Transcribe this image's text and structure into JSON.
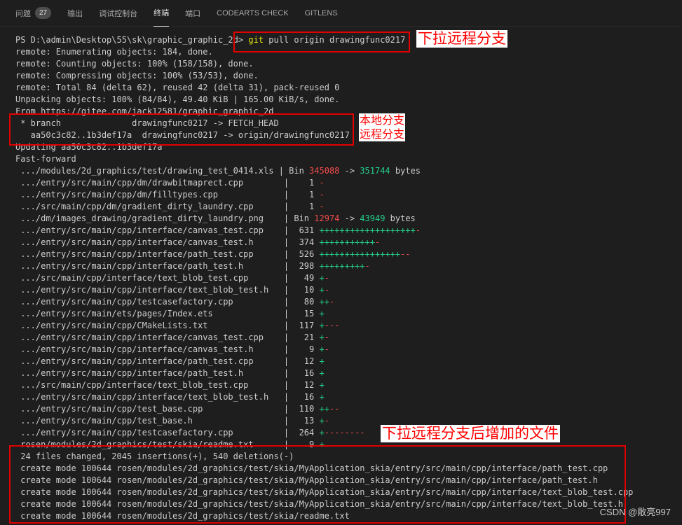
{
  "panel_tabs": [
    {
      "label": "问题",
      "badge": "27"
    },
    {
      "label": "输出"
    },
    {
      "label": "调试控制台"
    },
    {
      "label": "终端",
      "active": true
    },
    {
      "label": "端口"
    },
    {
      "label": "CODEARTS CHECK"
    },
    {
      "label": "GITLENS"
    }
  ],
  "terminal": {
    "prompt": "PS D:\\admin\\Desktop\\55\\sk\\graphic_graphic_2d>",
    "command_git": "git",
    "command_rest": " pull origin drawingfunc0217",
    "lines_head": [
      "remote: Enumerating objects: 184, done.",
      "remote: Counting objects: 100% (158/158), done.",
      "remote: Compressing objects: 100% (53/53), done.",
      "remote: Total 84 (delta 62), reused 42 (delta 31), pack-reused 0",
      "Unpacking objects: 100% (84/84), 49.40 KiB | 165.00 KiB/s, done.",
      "From https://gitee.com/jack12581/graphic_graphic_2d",
      " * branch              drawingfunc0217 -> FETCH_HEAD",
      "   aa50c3c82..1b3def17a  drawingfunc0217 -> origin/drawingfunc0217",
      "Updating aa50c3c82..1b3def17a",
      "Fast-forward"
    ],
    "diffstat": [
      {
        "file": " .../modules/2d_graphics/test/drawing_test_0414.xls ",
        "bin": true,
        "from": "345088",
        "to": "351744",
        "unit": " bytes"
      },
      {
        "file": " .../entry/src/main/cpp/dm/drawbitmaprect.cpp        ",
        "count": "   1 ",
        "plus": "",
        "minus": "-"
      },
      {
        "file": " .../entry/src/main/cpp/dm/filltypes.cpp             ",
        "count": "   1 ",
        "plus": "",
        "minus": "-"
      },
      {
        "file": " .../src/main/cpp/dm/gradient_dirty_laundry.cpp      ",
        "count": "   1 ",
        "plus": "",
        "minus": "-"
      },
      {
        "file": " .../dm/images_drawing/gradient_dirty_laundry.png    ",
        "bin": true,
        "from": "12974",
        "to": "43949",
        "unit": " bytes"
      },
      {
        "file": " .../entry/src/main/cpp/interface/canvas_test.cpp    ",
        "count": " 631 ",
        "plus": "+++++++++++++++++++",
        "minus": "-"
      },
      {
        "file": " .../entry/src/main/cpp/interface/canvas_test.h      ",
        "count": " 374 ",
        "plus": "+++++++++++",
        "minus": "-"
      },
      {
        "file": " .../entry/src/main/cpp/interface/path_test.cpp      ",
        "count": " 526 ",
        "plus": "++++++++++++++++",
        "minus": "--"
      },
      {
        "file": " .../entry/src/main/cpp/interface/path_test.h        ",
        "count": " 298 ",
        "plus": "+++++++++",
        "minus": "-"
      },
      {
        "file": " .../src/main/cpp/interface/text_blob_test.cpp       ",
        "count": "  49 ",
        "plus": "+",
        "minus": "-"
      },
      {
        "file": " .../entry/src/main/cpp/interface/text_blob_test.h   ",
        "count": "  10 ",
        "plus": "+",
        "minus": "-"
      },
      {
        "file": " .../entry/src/main/cpp/testcasefactory.cpp          ",
        "count": "  80 ",
        "plus": "++",
        "minus": "-"
      },
      {
        "file": " .../entry/src/main/ets/pages/Index.ets              ",
        "count": "  15 ",
        "plus": "+",
        "minus": ""
      },
      {
        "file": " .../entry/src/main/cpp/CMakeLists.txt               ",
        "count": " 117 ",
        "plus": "+",
        "minus": "---"
      },
      {
        "file": " .../entry/src/main/cpp/interface/canvas_test.cpp    ",
        "count": "  21 ",
        "plus": "+",
        "minus": "-"
      },
      {
        "file": " .../entry/src/main/cpp/interface/canvas_test.h      ",
        "count": "   9 ",
        "plus": "+",
        "minus": "-"
      },
      {
        "file": " .../entry/src/main/cpp/interface/path_test.cpp      ",
        "count": "  12 ",
        "plus": "+",
        "minus": ""
      },
      {
        "file": " .../entry/src/main/cpp/interface/path_test.h        ",
        "count": "  16 ",
        "plus": "+",
        "minus": ""
      },
      {
        "file": " .../src/main/cpp/interface/text_blob_test.cpp       ",
        "count": "  12 ",
        "plus": "+",
        "minus": ""
      },
      {
        "file": " .../entry/src/main/cpp/interface/text_blob_test.h   ",
        "count": "  16 ",
        "plus": "+",
        "minus": ""
      },
      {
        "file": " .../entry/src/main/cpp/test_base.cpp                ",
        "count": " 110 ",
        "plus": "++",
        "minus": "--"
      },
      {
        "file": " .../entry/src/main/cpp/test_base.h                  ",
        "count": "  13 ",
        "plus": "+",
        "minus": "-"
      },
      {
        "file": " .../entry/src/main/cpp/testcasefactory.cpp          ",
        "count": " 264 ",
        "plus": "+",
        "minus": "--------"
      },
      {
        "file": " rosen/modules/2d_graphics/test/skia/readme.txt      ",
        "count": "   9 ",
        "plus": "+",
        "minus": ""
      }
    ],
    "summary": " 24 files changed, 2045 insertions(+), 540 deletions(-)",
    "create_lines": [
      " create mode 100644 rosen/modules/2d_graphics/test/skia/MyApplication_skia/entry/src/main/cpp/interface/path_test.cpp",
      " create mode 100644 rosen/modules/2d_graphics/test/skia/MyApplication_skia/entry/src/main/cpp/interface/path_test.h",
      " create mode 100644 rosen/modules/2d_graphics/test/skia/MyApplication_skia/entry/src/main/cpp/interface/text_blob_test.cpp",
      " create mode 100644 rosen/modules/2d_graphics/test/skia/MyApplication_skia/entry/src/main/cpp/interface/text_blob_test.h",
      " create mode 100644 rosen/modules/2d_graphics/test/skia/readme.txt"
    ]
  },
  "annotations": {
    "pull_remote": "下拉远程分支",
    "local_branch": "本地分支",
    "remote_branch": "远程分支",
    "added_files": "下拉远程分支后增加的文件"
  },
  "watermark": "CSDN @敞亮997",
  "colors": {
    "background": "#1e1e1e",
    "text": "#cccccc",
    "git_keyword": "#e5e510",
    "diff_plus": "#23d18b",
    "diff_minus": "#f14c4c",
    "annotation": "#ff0000"
  }
}
